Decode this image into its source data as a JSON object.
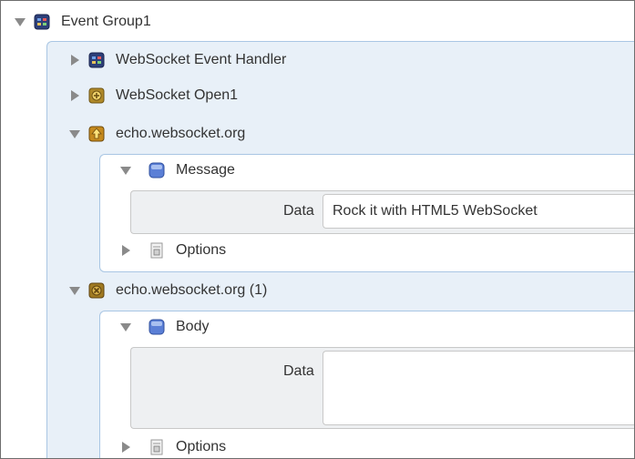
{
  "tree": {
    "root": {
      "label": "Event Group1",
      "icon": "event-group-icon"
    },
    "handler": {
      "label": "WebSocket Event Handler",
      "icon": "event-handler-icon"
    },
    "open": {
      "label": "WebSocket Open1",
      "icon": "websocket-open-icon"
    },
    "send": {
      "label": "echo.websocket.org",
      "icon": "websocket-send-icon",
      "message": {
        "label": "Message",
        "icon": "message-icon"
      },
      "data_label": "Data",
      "data_value": "Rock it with HTML5 WebSocket",
      "options": {
        "label": "Options",
        "icon": "options-icon"
      }
    },
    "close": {
      "label": "echo.websocket.org (1)",
      "icon": "websocket-close-icon",
      "body": {
        "label": "Body",
        "icon": "body-icon"
      },
      "data_label": "Data",
      "data_value": "",
      "options": {
        "label": "Options",
        "icon": "options-icon"
      }
    }
  },
  "colors": {
    "panel_bg": "#e8f0f8",
    "panel_border": "#a9c6e4",
    "data_well_bg": "#eef0f2",
    "triangle": "#8a8a8a"
  }
}
